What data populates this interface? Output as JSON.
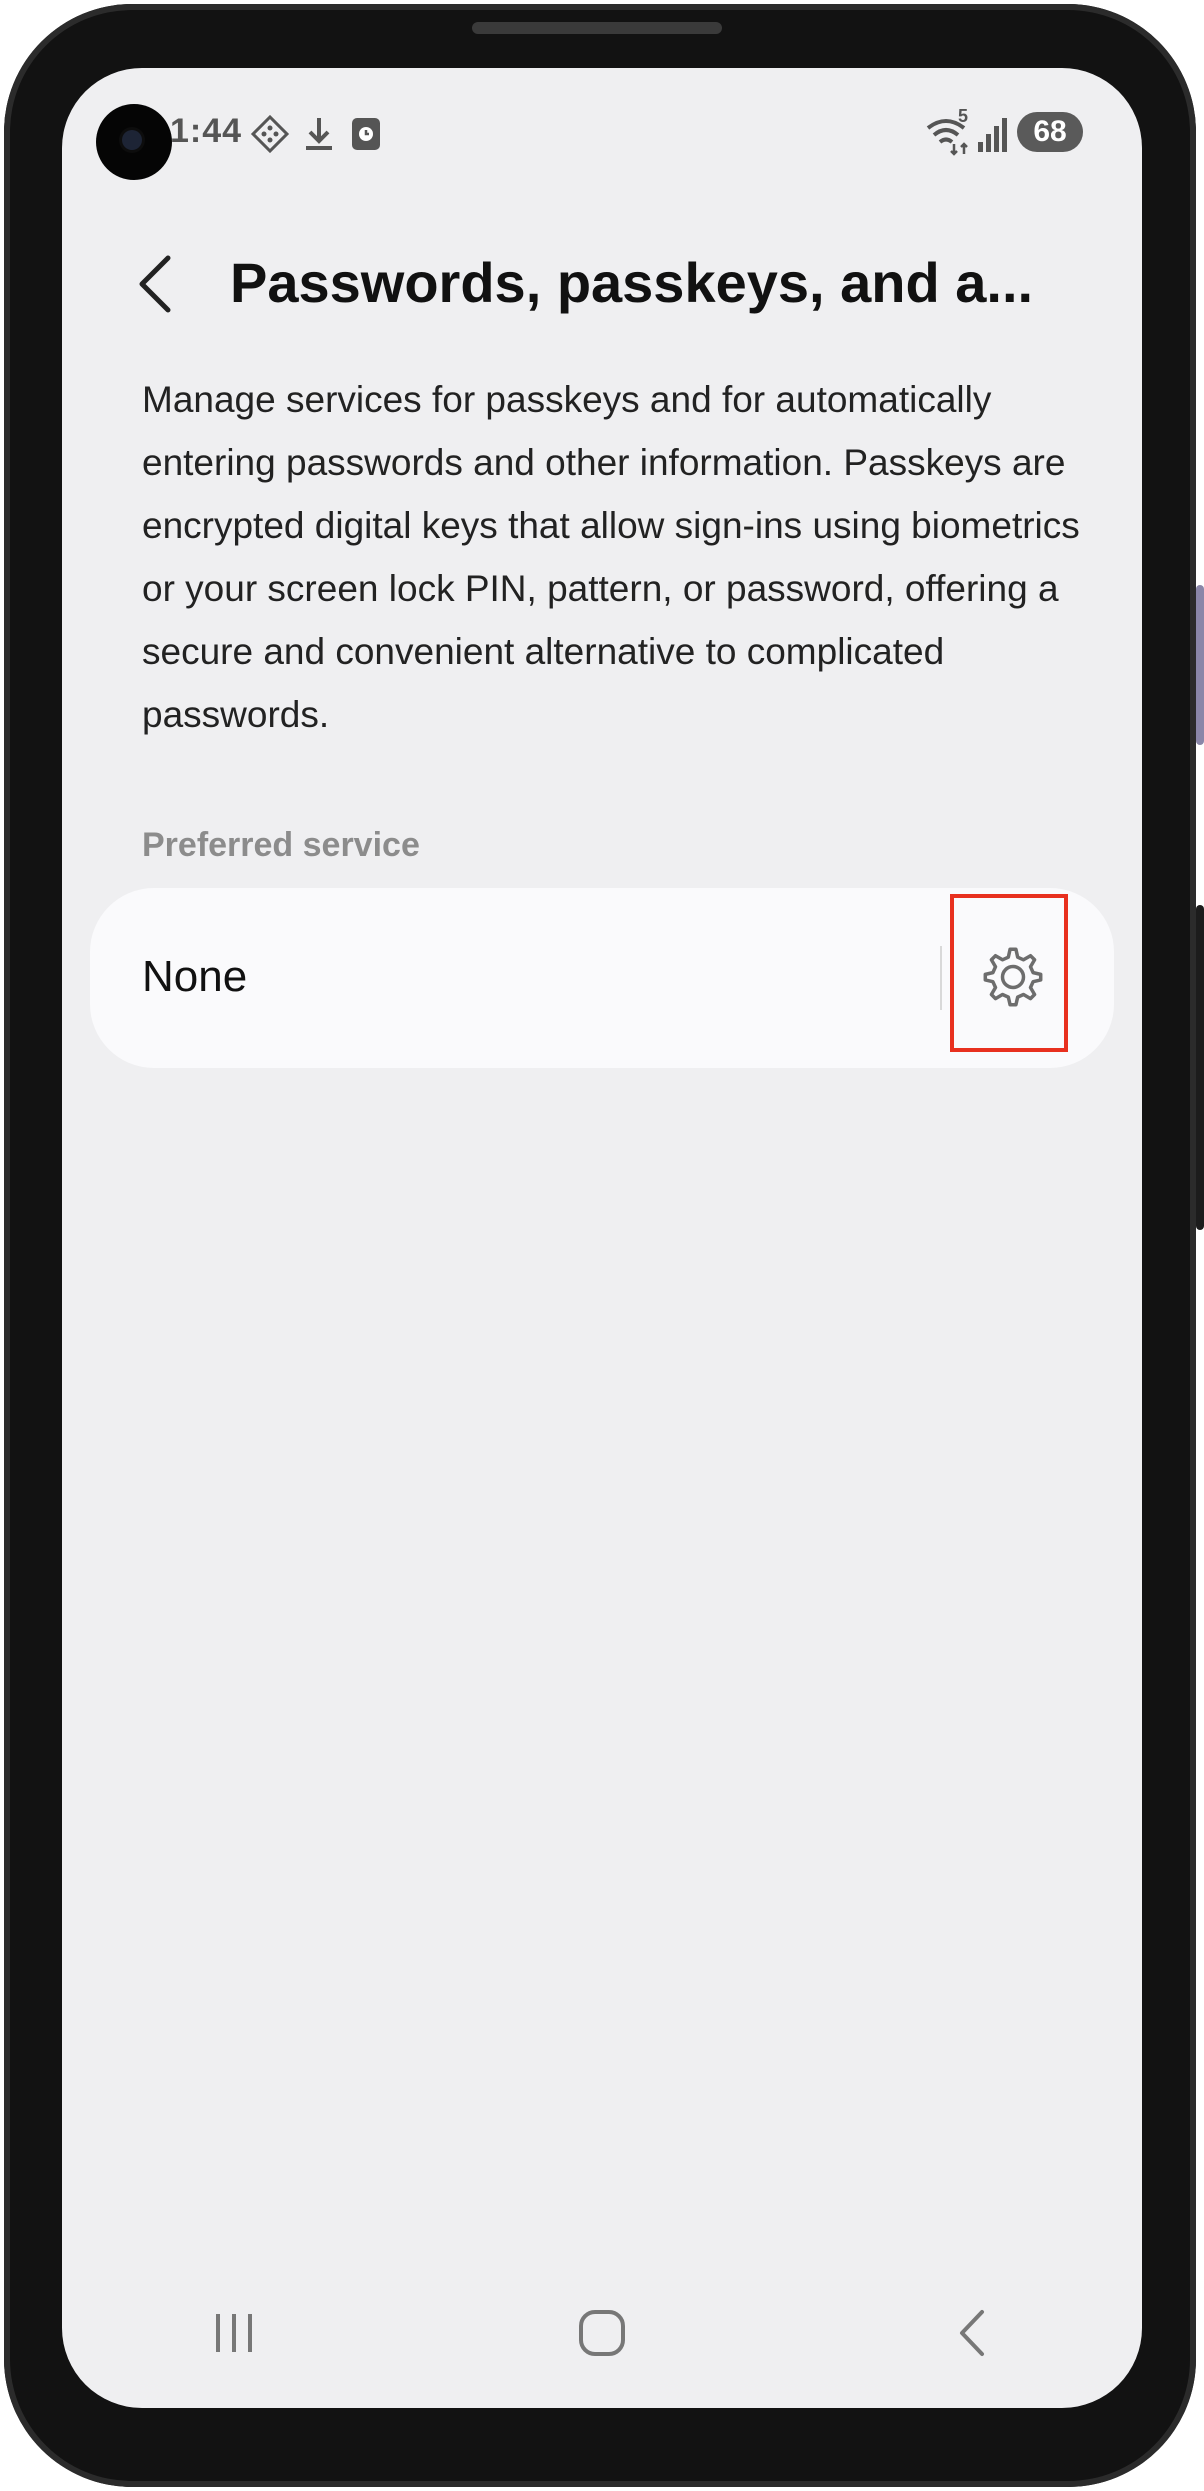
{
  "status_bar": {
    "time": "1:44",
    "icons": [
      "gallery-icon",
      "download-icon",
      "clock-app-icon",
      "wifi-icon",
      "signal-icon"
    ],
    "wifi_label": "5",
    "battery": "68"
  },
  "header": {
    "back_icon": "chevron-left-icon",
    "title": "Passwords, passkeys, and a..."
  },
  "description": "Manage services for passkeys and for automatically entering passwords and other information. Passkeys are encrypted digital keys that allow sign-ins using biometrics or your screen lock PIN, pattern, or password, offering a secure and convenient alternative to complicated passwords.",
  "preferred_service": {
    "label": "Preferred service",
    "value": "None",
    "settings_icon": "gear-icon"
  },
  "nav_bar": {
    "recents_icon": "recents-icon",
    "home_icon": "home-icon",
    "back_icon": "back-icon"
  },
  "colors": {
    "highlight": "#e8301f",
    "screen_bg": "#efeff1",
    "card_bg": "#fafafc"
  }
}
